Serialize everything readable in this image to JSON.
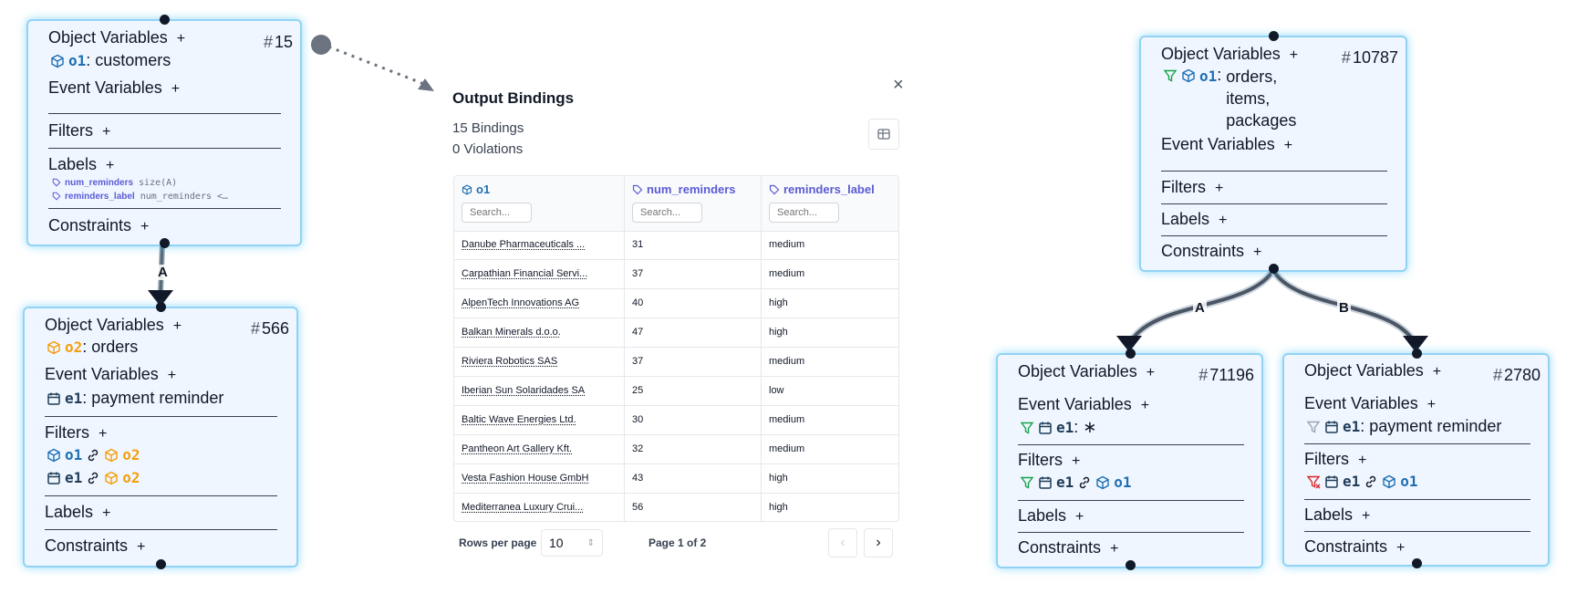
{
  "nodes": {
    "n15": {
      "id": "15",
      "object_variables": "Object Variables",
      "o1_name": "o1",
      "o1_type": "customers",
      "event_variables": "Event Variables",
      "filters": "Filters",
      "labels": "Labels",
      "label_items": [
        {
          "name": "num_reminders",
          "value": "size(A)"
        },
        {
          "name": "reminders_label",
          "value": "num_reminders <…"
        }
      ],
      "constraints": "Constraints"
    },
    "n566": {
      "id": "566",
      "object_variables": "Object Variables",
      "o2_name": "o2",
      "o2_type": "orders",
      "event_variables": "Event Variables",
      "e1_name": "e1",
      "e1_type": "payment reminder",
      "filters": "Filters",
      "filter1_a": "o1",
      "filter1_b": "o2",
      "filter2_a": "e1",
      "filter2_b": "o2",
      "labels": "Labels",
      "constraints": "Constraints"
    },
    "n10787": {
      "id": "10787",
      "object_variables": "Object Variables",
      "o1_name": "o1",
      "o1_types": [
        "orders,",
        "items,",
        "packages"
      ],
      "event_variables": "Event Variables",
      "filters": "Filters",
      "labels": "Labels",
      "constraints": "Constraints"
    },
    "n71196": {
      "id": "71196",
      "object_variables": "Object Variables",
      "event_variables": "Event Variables",
      "e1_name": "e1",
      "e1_type": "∗",
      "filters": "Filters",
      "filter_a": "e1",
      "filter_b": "o1",
      "labels": "Labels",
      "constraints": "Constraints"
    },
    "n2780": {
      "id": "2780",
      "object_variables": "Object Variables",
      "event_variables": "Event Variables",
      "e1_name": "e1",
      "e1_type": "payment reminder",
      "filters": "Filters",
      "filter_a": "e1",
      "filter_b": "o1",
      "labels": "Labels",
      "constraints": "Constraints"
    }
  },
  "edges": {
    "left_label": "A",
    "right_a": "A",
    "right_b": "B"
  },
  "output_panel": {
    "title": "Output Bindings",
    "bindings": "15 Bindings",
    "violations": "0 Violations",
    "close": "×",
    "columns": [
      {
        "label": "o1",
        "icon": "cube-icon",
        "color": "#1d6fb3"
      },
      {
        "label": "num_reminders",
        "icon": "tag-icon",
        "color": "#5b5bd6"
      },
      {
        "label": "reminders_label",
        "icon": "tag-icon",
        "color": "#5b5bd6"
      }
    ],
    "search_placeholder": "Search...",
    "rows": [
      [
        "Danube Pharmaceuticals ...",
        "31",
        "medium"
      ],
      [
        "Carpathian Financial Servi...",
        "37",
        "medium"
      ],
      [
        "AlpenTech Innovations AG",
        "40",
        "high"
      ],
      [
        "Balkan Minerals d.o.o.",
        "47",
        "high"
      ],
      [
        "Riviera Robotics SAS",
        "37",
        "medium"
      ],
      [
        "Iberian Sun Solaridades SA",
        "25",
        "low"
      ],
      [
        "Baltic Wave Energies Ltd.",
        "30",
        "medium"
      ],
      [
        "Pantheon Art Gallery Kft.",
        "32",
        "medium"
      ],
      [
        "Vesta Fashion House GmbH",
        "43",
        "high"
      ],
      [
        "Mediterranea Luxury Crui...",
        "56",
        "high"
      ]
    ],
    "rows_per_page_label": "Rows per page",
    "rows_per_page_value": "10",
    "page_info": "Page 1 of 2"
  },
  "colors": {
    "accent_blue": "#1d6fb3",
    "orange": "#f59e0b",
    "label_purple": "#5b5bd6",
    "filter_green": "#16a34a",
    "filter_red": "#dc2626"
  }
}
